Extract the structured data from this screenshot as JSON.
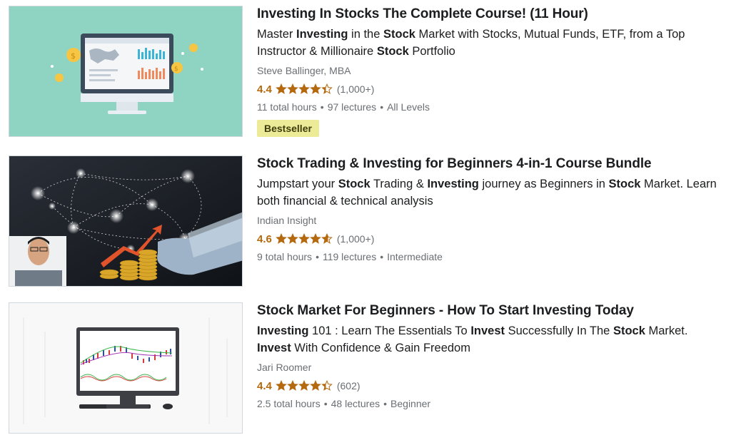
{
  "colors": {
    "rating": "#b4690e",
    "badge_bg": "#eceb98",
    "muted": "#6a6f73"
  },
  "courses": [
    {
      "title": "Investing In Stocks The Complete Course! (11 Hour)",
      "desc": [
        {
          "t": "Master ",
          "b": false
        },
        {
          "t": "Investing",
          "b": true
        },
        {
          "t": " in the ",
          "b": false
        },
        {
          "t": "Stock",
          "b": true
        },
        {
          "t": " Market with Stocks, Mutual Funds, ETF, from a Top Instructor & Millionaire ",
          "b": false
        },
        {
          "t": "Stock",
          "b": true
        },
        {
          "t": " Portfolio",
          "b": false
        }
      ],
      "author": "Steve Ballinger, MBA",
      "rating": "4.4",
      "stars": 4.4,
      "count": "(1,000+)",
      "hours": "11 total hours",
      "lectures": "97 lectures",
      "level": "All Levels",
      "badge": "Bestseller",
      "thumb_icon": "monitor-dashboard-icon"
    },
    {
      "title": "Stock Trading & Investing for Beginners 4-in-1 Course Bundle",
      "desc": [
        {
          "t": "Jumpstart your ",
          "b": false
        },
        {
          "t": "Stock",
          "b": true
        },
        {
          "t": " Trading & ",
          "b": false
        },
        {
          "t": "Investing",
          "b": true
        },
        {
          "t": " journey as Beginners in ",
          "b": false
        },
        {
          "t": "Stock",
          "b": true
        },
        {
          "t": " Market. Learn both financial & technical analysis",
          "b": false
        }
      ],
      "author": "Indian Insight",
      "rating": "4.6",
      "stars": 4.6,
      "count": "(1,000+)",
      "hours": "9 total hours",
      "lectures": "119 lectures",
      "level": "Intermediate",
      "thumb_icon": "network-growth-icon"
    },
    {
      "title": "Stock Market For Beginners - How To Start Investing Today",
      "desc": [
        {
          "t": "Investing",
          "b": true
        },
        {
          "t": " 101 : Learn The Essentials To ",
          "b": false
        },
        {
          "t": "Invest",
          "b": true
        },
        {
          "t": " Successfully In The ",
          "b": false
        },
        {
          "t": "Stock",
          "b": true
        },
        {
          "t": " Market. ",
          "b": false
        },
        {
          "t": "Invest",
          "b": true
        },
        {
          "t": " With Confidence & Gain Freedom",
          "b": false
        }
      ],
      "author": "Jari Roomer",
      "rating": "4.4",
      "stars": 4.4,
      "count": "(602)",
      "hours": "2.5 total hours",
      "lectures": "48 lectures",
      "level": "Beginner",
      "thumb_icon": "computer-chart-icon"
    }
  ]
}
